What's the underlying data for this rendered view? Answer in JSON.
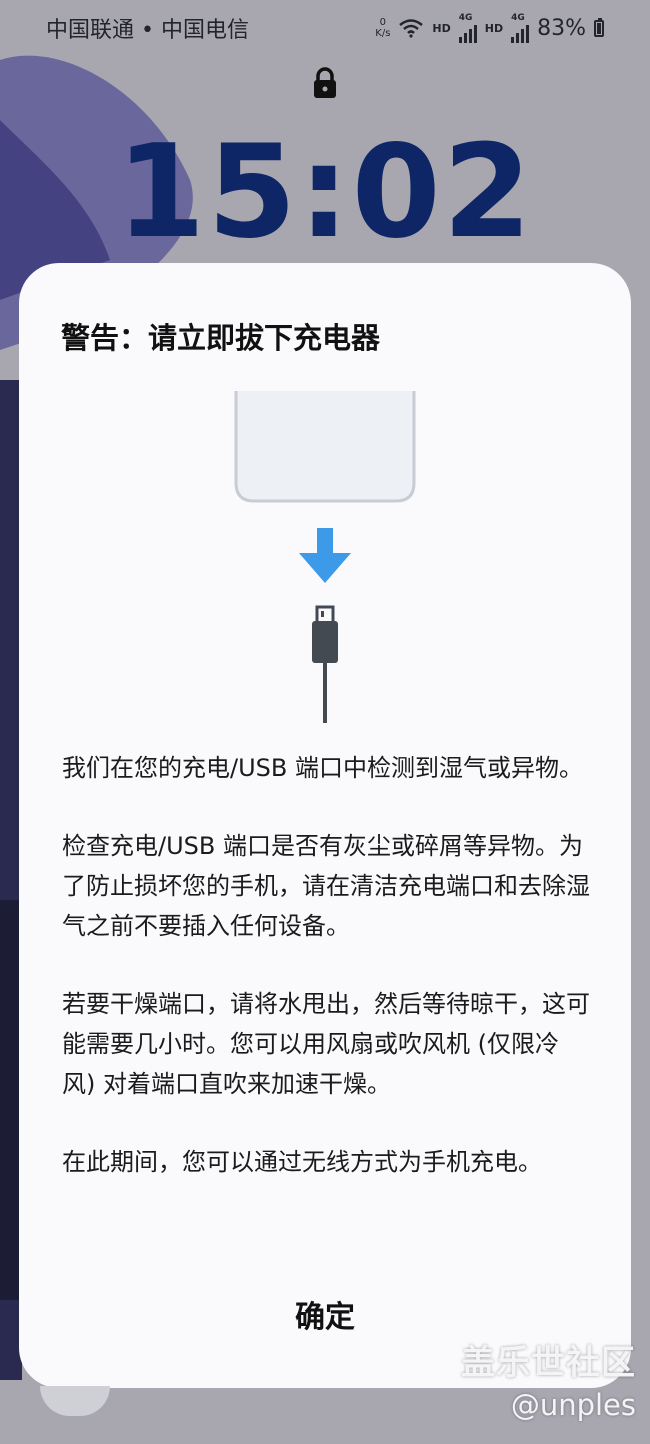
{
  "status_bar": {
    "carriers": "中国联通 • 中国电信",
    "speed_value": "0",
    "speed_unit": "K/s",
    "hd1": "HD",
    "net1": "4G",
    "hd2": "HD",
    "net2": "4G",
    "battery": "83%"
  },
  "lockscreen": {
    "time": "15:02"
  },
  "dialog": {
    "title": "警告：请立即拔下充电器",
    "paragraphs": [
      "我们在您的充电/USB 端口中检测到湿气或异物。",
      "检查充电/USB 端口是否有灰尘或碎屑等异物。为了防止损坏您的手机，请在清洁充电端口和去除湿气之前不要插入任何设备。",
      "若要干燥端口，请将水甩出，然后等待晾干，这可能需要几小时。您可以用风扇或吹风机 (仅限冷风) 对着端口直吹来加速干燥。",
      "在此期间，您可以通过无线方式为手机充电。"
    ],
    "confirm_label": "确定"
  },
  "watermark": {
    "line1": "盖乐世社区",
    "line2": "@unples"
  },
  "colors": {
    "clock": "#0e2566",
    "arrow": "#3d9ae8",
    "dialog_bg": "#fafafd"
  },
  "icons": [
    "lock-icon",
    "wifi-icon",
    "signal-icon",
    "battery-icon",
    "down-arrow-icon",
    "usb-plug-icon"
  ]
}
